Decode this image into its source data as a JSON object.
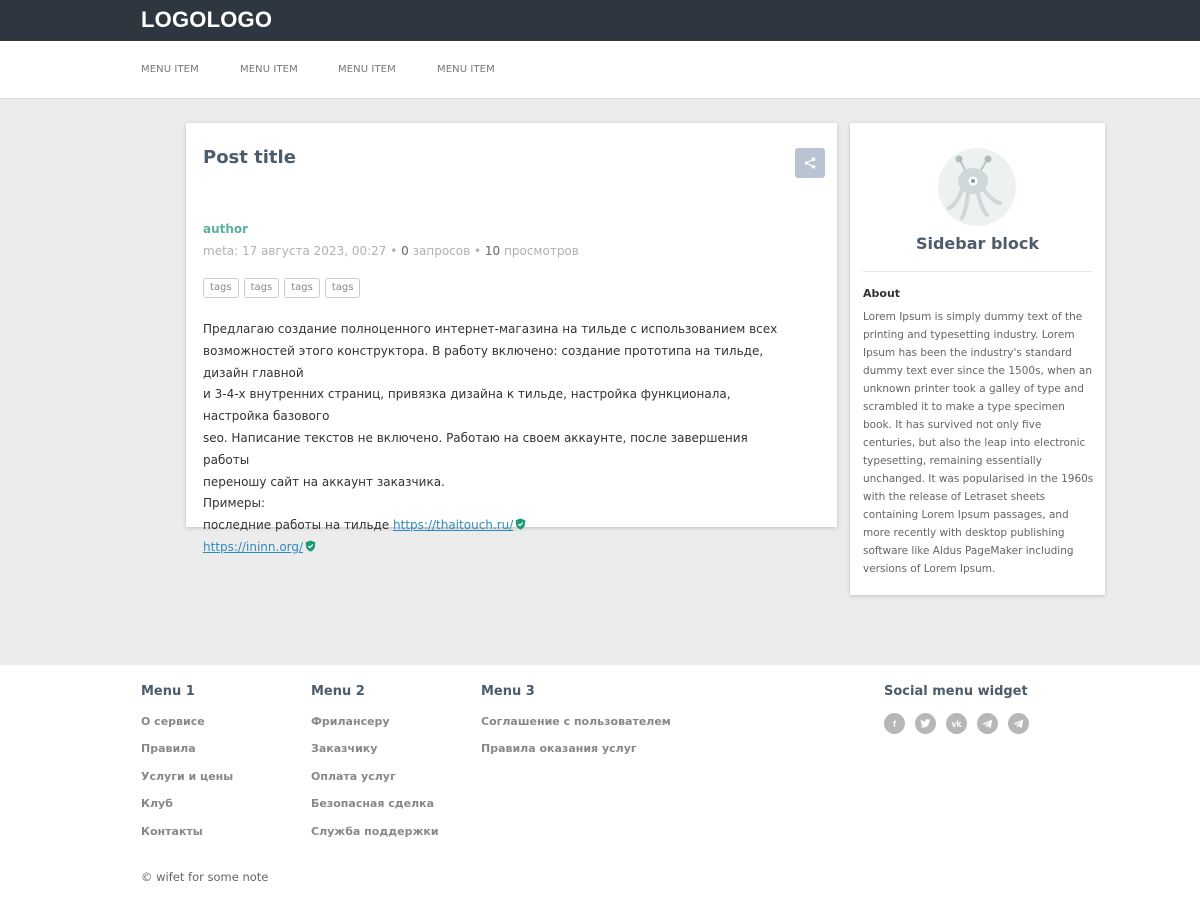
{
  "header": {
    "logo": "LOGOLOGO"
  },
  "nav": {
    "items": [
      "MENU ITEM",
      "MENU ITEM",
      "MENU ITEM",
      "MENU ITEM"
    ]
  },
  "post": {
    "title": "Post title",
    "share_icon": "share-icon",
    "author": "author",
    "meta": {
      "prefix": "meta: 17 августа 2023, 00:27",
      "separator": "•",
      "requests_count": "0",
      "requests_label": "запросов",
      "views_count": "10",
      "views_label": "просмотров"
    },
    "tags": [
      "tags",
      "tags",
      "tags",
      "tags"
    ],
    "body_lines": [
      "Предлагаю создание полноценного интернет-магазина на тильде с использованием всех",
      "возможностей этого конструктора. В работу включено: создание прототипа на тильде, дизайн главной",
      "и 3-4-х внутренних страниц, привязка дизайна к тильде, настройка функционала, настройка базового",
      "seo. Написание текстов не включено. Работаю на своем аккаунте, после завершения работы",
      "переношу сайт на аккаунт заказчика.",
      "Примеры:"
    ],
    "link1_prefix": "последние работы на тильде",
    "link1": "https://thaitouch.ru/",
    "link2": "https://ininn.org/"
  },
  "sidebar": {
    "title": "Sidebar block",
    "about_heading": "About",
    "about_text": "Lorem Ipsum is simply dummy text of the printing and typesetting industry. Lorem Ipsum has been the industry's standard dummy text ever since the 1500s, when an unknown printer took a galley of type and scrambled it to make a type specimen book. It has survived not only five centuries, but also the leap into electronic typesetting, remaining essentially unchanged. It was popularised in the 1960s with the release of Letraset sheets containing Lorem Ipsum passages, and more recently with desktop publishing software like Aldus PageMaker including versions of Lorem Ipsum."
  },
  "footer": {
    "menus": [
      {
        "title": "Menu 1",
        "links": [
          "О сервисе",
          "Правила",
          "Услуги и цены",
          "Клуб",
          "Контакты"
        ]
      },
      {
        "title": "Menu 2",
        "links": [
          "Фрилансеру",
          "Заказчику",
          "Оплата услуг",
          "Безопасная сделка",
          "Служба поддержки"
        ]
      },
      {
        "title": "Menu 3",
        "links": [
          "Соглашение с пользователем",
          "Правила оказания услуг"
        ]
      }
    ],
    "social_title": "Social menu widget",
    "social_icons": [
      {
        "name": "facebook-icon",
        "glyph": "f"
      },
      {
        "name": "twitter-icon",
        "glyph": "t"
      },
      {
        "name": "vk-icon",
        "glyph": "vk"
      },
      {
        "name": "telegram-icon",
        "glyph": ""
      },
      {
        "name": "telegram-icon",
        "glyph": ""
      }
    ],
    "copyright": "© wifet for some note"
  },
  "colors": {
    "topbar": "#2e3640",
    "title": "#4d5b6b",
    "author": "#59b1a1",
    "link": "#2d8bbf",
    "shield": "#1e9a78",
    "share_button": "#b9c3d1",
    "social": "#b7b7b7"
  }
}
